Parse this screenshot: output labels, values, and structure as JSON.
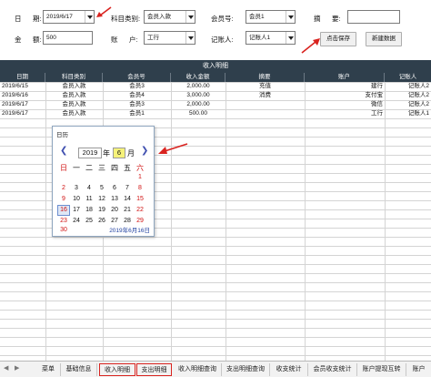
{
  "form": {
    "date_label": "日      期:",
    "date_value": "2019/6/17",
    "category_label": "科目类别:",
    "category_value": "会员入款",
    "member_label": "会员号:",
    "member_value": "会员1",
    "summary_label": "摘      要:",
    "summary_value": "",
    "amount_label": "金      额:",
    "amount_value": "500",
    "account_label": "账      户:",
    "account_value": "工行",
    "recorder_label": "记账人:",
    "recorder_value": "记账人1",
    "save_button": "点击保存",
    "new_button": "新建数据",
    "accent_color": "#d9231f"
  },
  "table": {
    "title": "收入明细",
    "header_color": "#2f3f4c",
    "columns": [
      "日期",
      "科目类别",
      "会员号",
      "收入金额",
      "摘要",
      "账户",
      "记账人"
    ],
    "rows": [
      [
        "2019/6/15",
        "会员入款",
        "会员3",
        "2,000.00",
        "充值",
        "建行",
        "记账人2"
      ],
      [
        "2019/6/16",
        "会员入款",
        "会员4",
        "3,000.00",
        "消费",
        "支付宝",
        "记账人2"
      ],
      [
        "2019/6/17",
        "会员入款",
        "会员3",
        "2,000.00",
        "",
        "微信",
        "记账人2"
      ],
      [
        "2019/6/17",
        "会员入款",
        "会员1",
        "500.00",
        "",
        "工行",
        "记账人1"
      ]
    ]
  },
  "calendar": {
    "title": "日历",
    "year": "2019",
    "year_unit": "年",
    "month": "6",
    "month_unit": "月",
    "weekdays": [
      "日",
      "一",
      "二",
      "三",
      "四",
      "五",
      "六"
    ],
    "days": [
      "1",
      "2",
      "3",
      "4",
      "5",
      "6",
      "7",
      "8",
      "9",
      "10",
      "11",
      "12",
      "13",
      "14",
      "15",
      "16",
      "17",
      "18",
      "19",
      "20",
      "21",
      "22",
      "23",
      "24",
      "25",
      "26",
      "27",
      "28",
      "29",
      "30"
    ],
    "selected_day": "16",
    "today_text": "2019年6月16日"
  },
  "tabs": [
    "菜单",
    "基础信息",
    "收入明细",
    "支出明细",
    "收入明细查询",
    "支出明细查询",
    "收支统计",
    "会员收支统计",
    "账户提现互转",
    "账户"
  ]
}
